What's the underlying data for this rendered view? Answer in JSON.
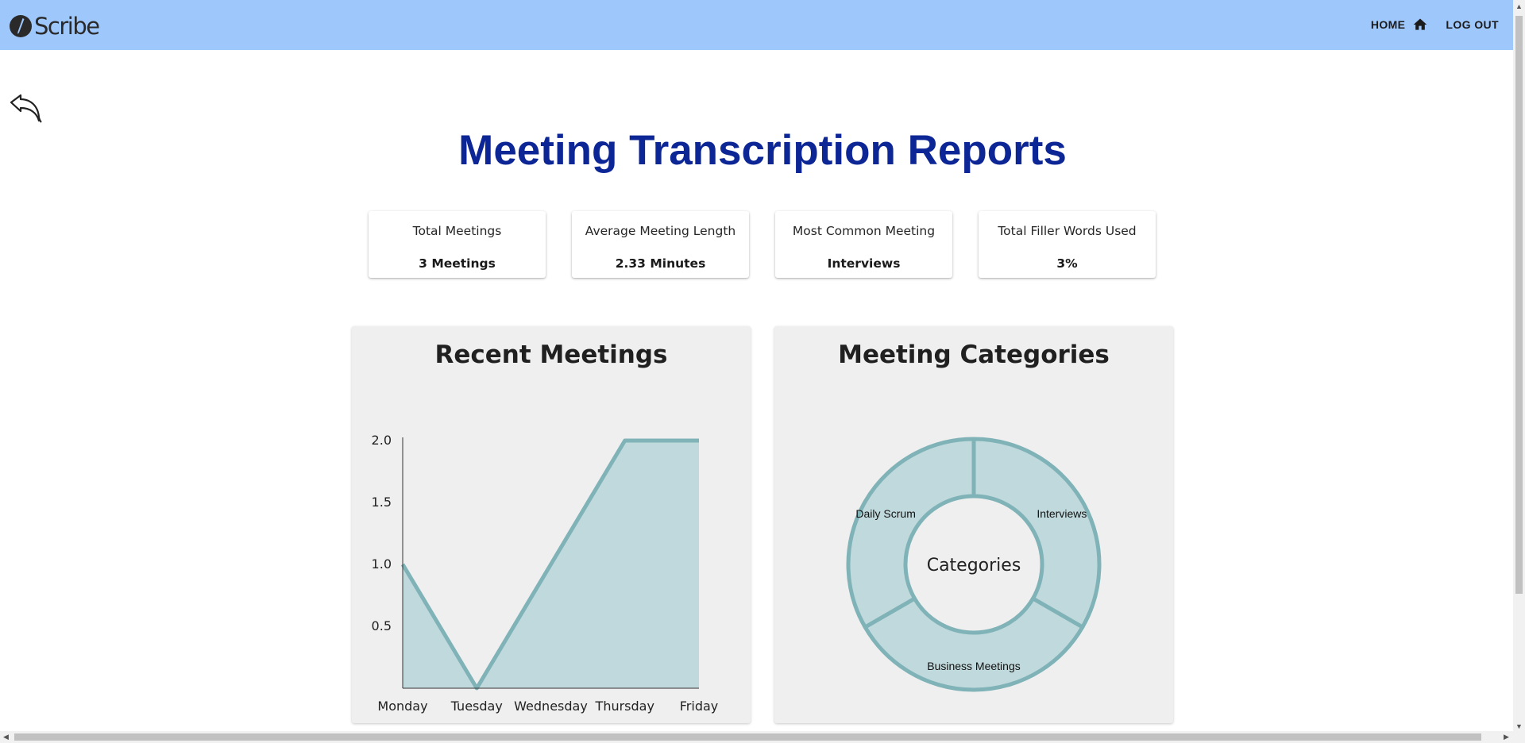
{
  "header": {
    "app_name": "Scribe",
    "logo_icon": "pen-nib-icon",
    "nav": {
      "home_label": "HOME",
      "home_icon": "home-icon",
      "logout_label": "LOG OUT"
    },
    "background": "#9ec7fc"
  },
  "back_icon": "back-arrow-icon",
  "page_title": "Meeting Transcription Reports",
  "title_color": "#0d2696",
  "stats": [
    {
      "label": "Total Meetings",
      "value": "3 Meetings"
    },
    {
      "label": "Average Meeting Length",
      "value": "2.33 Minutes"
    },
    {
      "label": "Most Common Meeting",
      "value": "Interviews"
    },
    {
      "label": "Total Filler Words Used",
      "value": "3%"
    }
  ],
  "panels": {
    "recent_title": "Recent Meetings",
    "categories_title": "Meeting Categories"
  },
  "accent_color": "#7fb3b8",
  "fill_color": "#c0d9dc",
  "chart_data": [
    {
      "type": "area",
      "title": "Recent Meetings",
      "categories": [
        "Monday",
        "Tuesday",
        "Wednesday",
        "Thursday",
        "Friday"
      ],
      "values": [
        1,
        0,
        1,
        2,
        2
      ],
      "y_ticks": [
        "2.0",
        "1.5",
        "1.0",
        "0.5"
      ],
      "ylim": [
        0,
        2
      ],
      "grid": false
    },
    {
      "type": "pie",
      "title": "Meeting Categories",
      "donut": true,
      "center_label": "Categories",
      "labels": [
        "Interviews",
        "Business Meetings",
        "Daily Scrum"
      ],
      "values": [
        1,
        1,
        1
      ]
    }
  ]
}
